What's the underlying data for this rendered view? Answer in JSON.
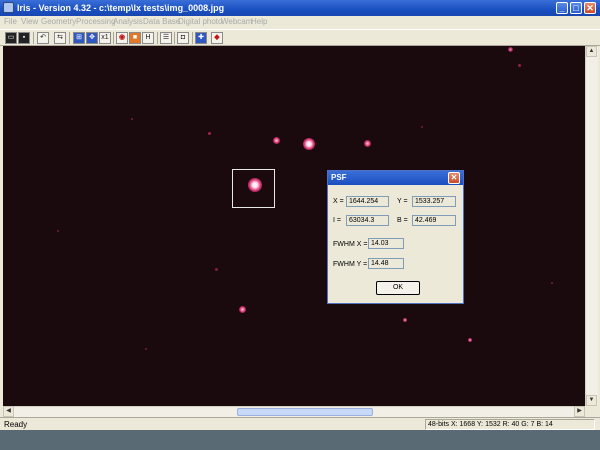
{
  "window": {
    "title": "Iris - Version 4.32 - c:\\temp\\lx tests\\img_0008.jpg",
    "minimize": "_",
    "maximize": "□",
    "close": "✕"
  },
  "menu": [
    "File",
    "View",
    "Geometry",
    "Processing",
    "Analysis",
    "Data Base",
    "Digital photo",
    "Webcam",
    "Help"
  ],
  "toolbar": {
    "t_load": "▭",
    "t_save": "▪",
    "t_undo": "↶",
    "t_flip": "⇆",
    "t_grid": "⊞",
    "t_move": "✥",
    "t_x1": "x1",
    "t_circle": "◉",
    "t_color": "■",
    "t_h": "H",
    "t_list": "☰",
    "t_camera": "◘",
    "t_cross": "✚",
    "t_dot": "◆"
  },
  "scroll": {
    "up": "▲",
    "down": "▼",
    "left": "◀",
    "right": "▶"
  },
  "status": {
    "ready": "Ready",
    "pixel_info": "48-bits X: 1668  Y: 1532  R: 40  G: 7  B: 14"
  },
  "psf": {
    "title": "PSF",
    "close": "✕",
    "x_label": "X =",
    "x_value": "1644.254",
    "y_label": "Y =",
    "y_value": "1533.257",
    "i_label": "I =",
    "i_value": "63034.3",
    "b_label": "B =",
    "b_value": "42.469",
    "fwhm_x_label": "FWHM X =",
    "fwhm_x_value": "14.03",
    "fwhm_y_label": "FWHM Y =",
    "fwhm_y_value": "14.48",
    "ok": "OK"
  },
  "colors": {
    "sky": "#1a0a0e",
    "title_bar": "#1a4fc0",
    "window_bg": "#ece9d8"
  }
}
